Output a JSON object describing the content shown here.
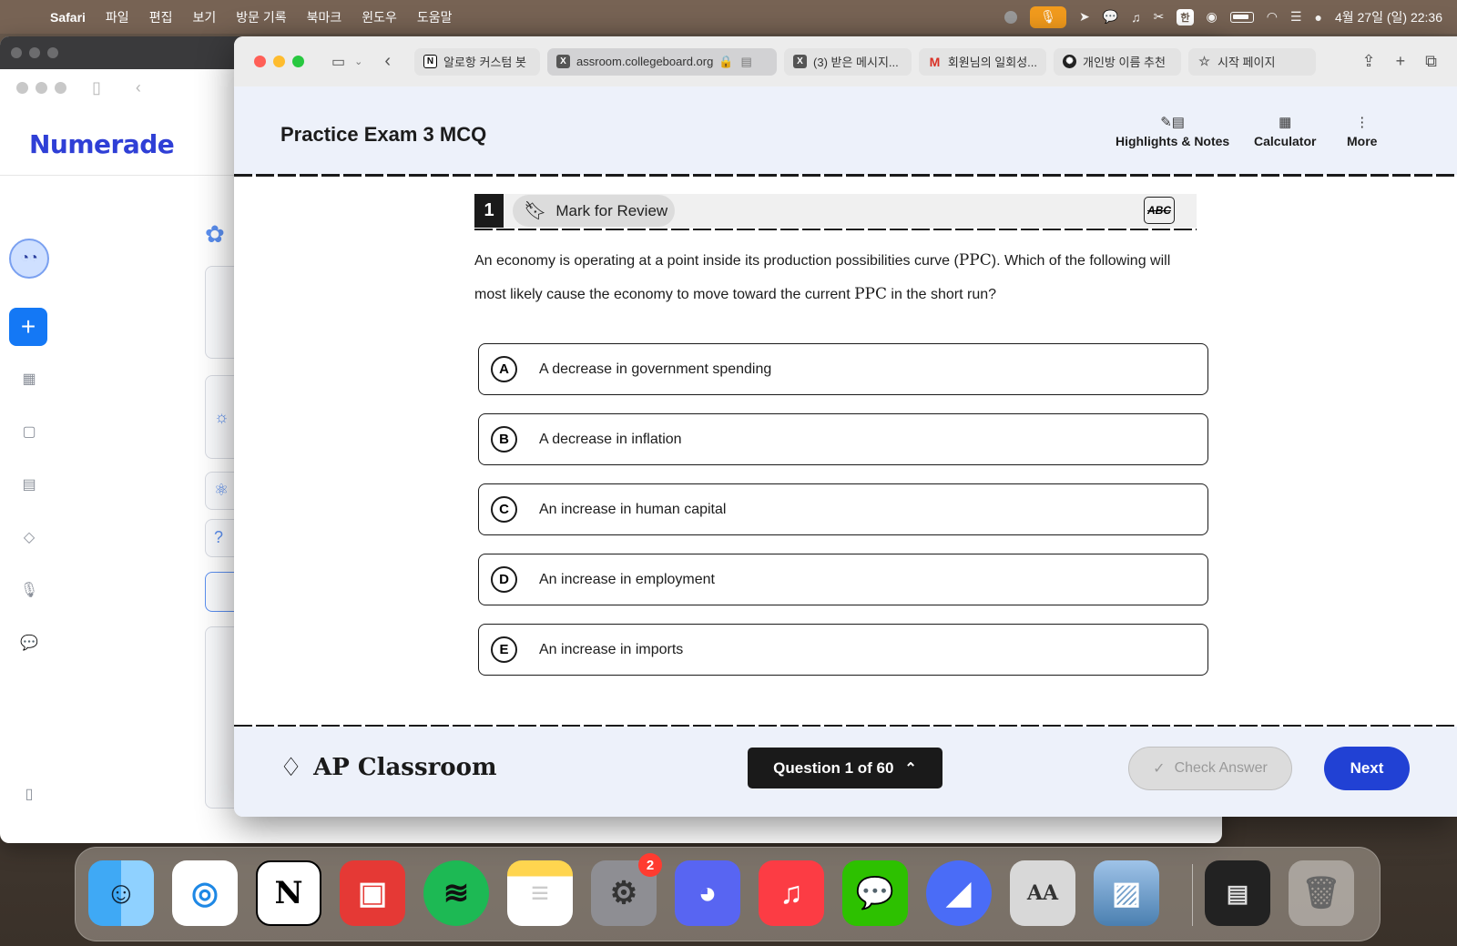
{
  "menubar": {
    "app": "Safari",
    "items": [
      "파일",
      "편집",
      "보기",
      "방문 기록",
      "북마크",
      "윈도우",
      "도움말"
    ],
    "han": "한",
    "datetime": "4월 27일 (일) 22:36"
  },
  "back_window": {
    "logo": "Numerade",
    "col2_help": "?"
  },
  "safari": {
    "tabs": [
      {
        "label": "알로항 커스텀 봇",
        "favicon": "N"
      },
      {
        "label": "assroom.collegeboard.org",
        "favicon": "X",
        "active": true
      },
      {
        "label": "(3) 받은 메시지...",
        "favicon": "X"
      },
      {
        "label": "회원님의 일회성...",
        "favicon": "M"
      },
      {
        "label": "개인방 이름 추천",
        "favicon": "gpt"
      },
      {
        "label": "시작 페이지",
        "favicon": "star"
      }
    ]
  },
  "exam": {
    "title": "Practice Exam 3 MCQ",
    "tools": {
      "highlights": "Highlights & Notes",
      "calculator": "Calculator",
      "more": "More"
    },
    "question_number": "1",
    "mark_for_review": "Mark for Review",
    "abc_label": "ABC",
    "question": {
      "part1": "An economy is operating at a point inside its production possibilities curve (",
      "math1": "PPC",
      "part2": "). Which of the following will most likely cause the economy to move toward the current ",
      "math2": "PPC",
      "part3": " in the short run?"
    },
    "choices": [
      {
        "letter": "A",
        "text": "A decrease in government spending"
      },
      {
        "letter": "B",
        "text": "A decrease in inflation"
      },
      {
        "letter": "C",
        "text": "An increase in human capital"
      },
      {
        "letter": "D",
        "text": "An increase in employment"
      },
      {
        "letter": "E",
        "text": "An increase in imports"
      }
    ],
    "footer": {
      "brand": "AP Classroom",
      "question_nav": "Question 1 of 60",
      "check_answer": "Check Answer",
      "next": "Next"
    }
  },
  "dock": {
    "apps": [
      "Finder",
      "Safari",
      "Notion",
      "Photo Booth",
      "Spotify",
      "Notes",
      "System Settings",
      "Discord",
      "Music",
      "WeChat",
      "Paw",
      "Font Book",
      "Preview"
    ],
    "settings_badge": "2"
  },
  "colors": {
    "accent": "#2141d4",
    "exam_header_bg": "#edf1fa",
    "numerade_blue": "#2f3fd6"
  }
}
